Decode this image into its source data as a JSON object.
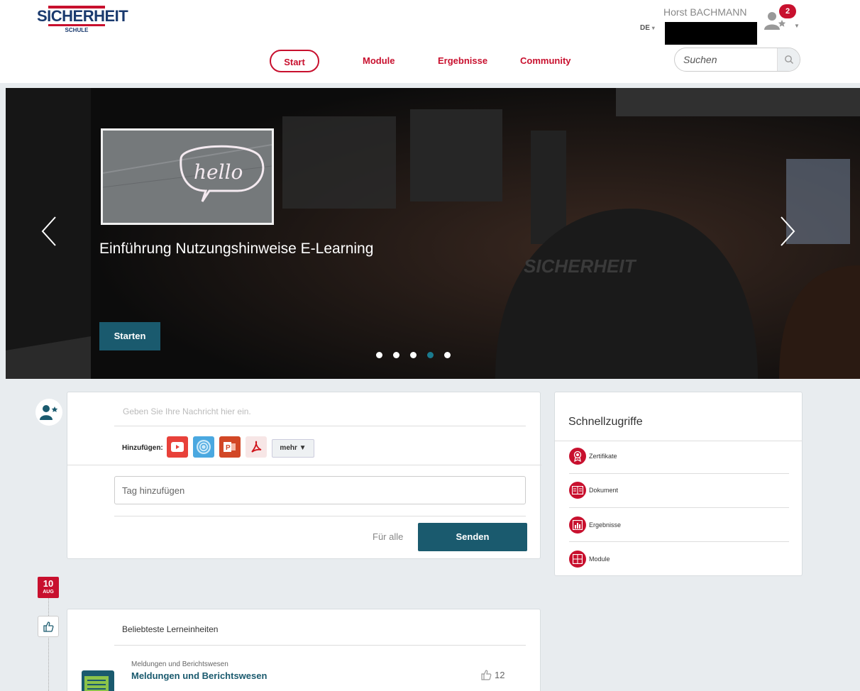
{
  "header": {
    "logo_main": "SICHERHEIT",
    "logo_sub": "SCHULE",
    "user_name": "Horst BACHMANN",
    "language": "DE",
    "notification_count": "2"
  },
  "nav": {
    "items": [
      "Start",
      "Module",
      "Ergebnisse",
      "Community"
    ],
    "active": "Start"
  },
  "search": {
    "placeholder": "Suchen"
  },
  "banner": {
    "slide_title": "Einführung Nutzungshinweise E-Learning",
    "start_button": "Starten",
    "thumb_text": "hello",
    "slide_count": 5,
    "active_slide_index": 3
  },
  "post": {
    "message_placeholder": "Geben Sie Ihre Nachricht hier ein.",
    "add_label": "Hinzufügen:",
    "more_button": "mehr ▼",
    "tag_placeholder": "Tag hinzufügen",
    "audience": "Für alle",
    "send_button": "Senden"
  },
  "quick_access": {
    "title": "Schnellzugriffe",
    "items": [
      "Zertifikate",
      "Dokument",
      "Ergebnisse",
      "Module"
    ]
  },
  "timeline": {
    "day": "10",
    "month": "AUG"
  },
  "popular": {
    "title": "Beliebteste Lerneinheiten",
    "item_category": "Meldungen und Berichtswesen",
    "item_title": "Meldungen und Berichtswesen",
    "item_likes": "12"
  },
  "colors": {
    "brand_red": "#c8102e",
    "brand_teal": "#1a5a6e",
    "logo_blue": "#1a3a6e"
  }
}
